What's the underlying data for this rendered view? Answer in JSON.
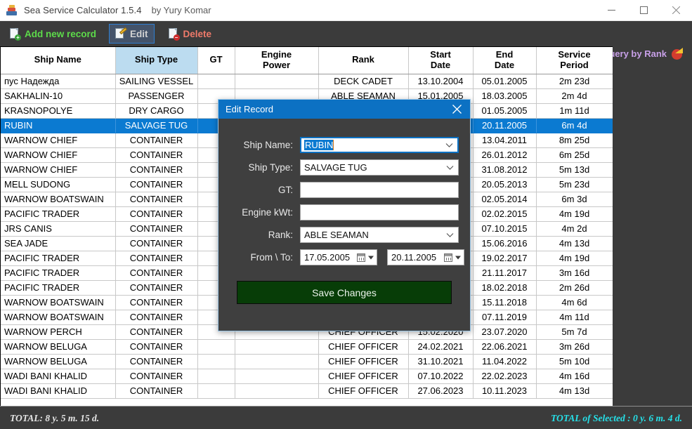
{
  "window": {
    "title": "Sea Service Calculator 1.5.4",
    "author": "by Yury Komar",
    "minimize": "—",
    "maximize": "□",
    "close": "✕"
  },
  "toolbar": {
    "add_label": "Add new record",
    "edit_label": "Edit",
    "delete_label": "Delete",
    "query_label": "Query by Rank"
  },
  "grid": {
    "columns": [
      {
        "label": "Ship Name",
        "key": "ship"
      },
      {
        "label": "Ship Type",
        "key": "type"
      },
      {
        "label": "GT",
        "key": "gt"
      },
      {
        "label": "Engine\nPower",
        "key": "engine"
      },
      {
        "label": "Rank",
        "key": "rank"
      },
      {
        "label": "Start\nDate",
        "key": "start"
      },
      {
        "label": "End\nDate",
        "key": "end"
      },
      {
        "label": "Service\nPeriod",
        "key": "period"
      }
    ],
    "selected_column": "Ship Type",
    "selected_row_index": 3,
    "rows": [
      {
        "ship": "пус Надежда",
        "type": "SAILING VESSEL",
        "gt": "",
        "engine": "",
        "rank": "DECK CADET",
        "start": "13.10.2004",
        "end": "05.01.2005",
        "period": "2m 23d"
      },
      {
        "ship": "SAKHALIN-10",
        "type": "PASSENGER",
        "gt": "",
        "engine": "",
        "rank": "ABLE SEAMAN",
        "start": "15.01.2005",
        "end": "18.03.2005",
        "period": "2m 4d"
      },
      {
        "ship": "KRASNOPOLYE",
        "type": "DRY CARGO",
        "gt": "",
        "engine": "",
        "rank": "",
        "start": "",
        "end": "01.05.2005",
        "period": "1m 11d"
      },
      {
        "ship": "RUBIN",
        "type": "SALVAGE TUG",
        "gt": "",
        "engine": "",
        "rank": "",
        "start": "",
        "end": "20.11.2005",
        "period": "6m 4d"
      },
      {
        "ship": "WARNOW CHIEF",
        "type": "CONTAINER",
        "gt": "",
        "engine": "",
        "rank": "",
        "start": "",
        "end": "13.04.2011",
        "period": "8m 25d"
      },
      {
        "ship": "WARNOW CHIEF",
        "type": "CONTAINER",
        "gt": "",
        "engine": "",
        "rank": "",
        "start": "",
        "end": "26.01.2012",
        "period": "6m 25d"
      },
      {
        "ship": "WARNOW CHIEF",
        "type": "CONTAINER",
        "gt": "",
        "engine": "",
        "rank": "",
        "start": "",
        "end": "31.08.2012",
        "period": "5m 13d"
      },
      {
        "ship": "MELL SUDONG",
        "type": "CONTAINER",
        "gt": "",
        "engine": "",
        "rank": "",
        "start": "",
        "end": "20.05.2013",
        "period": "5m 23d"
      },
      {
        "ship": "WARNOW BOATSWAIN",
        "type": "CONTAINER",
        "gt": "",
        "engine": "",
        "rank": "",
        "start": "",
        "end": "02.05.2014",
        "period": "6m 3d"
      },
      {
        "ship": "PACIFIC TRADER",
        "type": "CONTAINER",
        "gt": "",
        "engine": "",
        "rank": "",
        "start": "",
        "end": "02.02.2015",
        "period": "4m 19d"
      },
      {
        "ship": "JRS CANIS",
        "type": "CONTAINER",
        "gt": "",
        "engine": "",
        "rank": "",
        "start": "",
        "end": "07.10.2015",
        "period": "4m 2d"
      },
      {
        "ship": "SEA JADE",
        "type": "CONTAINER",
        "gt": "",
        "engine": "",
        "rank": "",
        "start": "",
        "end": "15.06.2016",
        "period": "4m 13d"
      },
      {
        "ship": "PACIFIC TRADER",
        "type": "CONTAINER",
        "gt": "",
        "engine": "",
        "rank": "",
        "start": "",
        "end": "19.02.2017",
        "period": "4m 19d"
      },
      {
        "ship": "PACIFIC TRADER",
        "type": "CONTAINER",
        "gt": "",
        "engine": "",
        "rank": "",
        "start": "",
        "end": "21.11.2017",
        "period": "3m 16d"
      },
      {
        "ship": "PACIFIC TRADER",
        "type": "CONTAINER",
        "gt": "",
        "engine": "",
        "rank": "",
        "start": "",
        "end": "18.02.2018",
        "period": "2m 26d"
      },
      {
        "ship": "WARNOW BOATSWAIN",
        "type": "CONTAINER",
        "gt": "",
        "engine": "",
        "rank": "",
        "start": "",
        "end": "15.11.2018",
        "period": "4m 6d"
      },
      {
        "ship": "WARNOW BOATSWAIN",
        "type": "CONTAINER",
        "gt": "",
        "engine": "",
        "rank": "",
        "start": "",
        "end": "07.11.2019",
        "period": "4m 11d"
      },
      {
        "ship": "WARNOW PERCH",
        "type": "CONTAINER",
        "gt": "",
        "engine": "",
        "rank": "CHIEF OFFICER",
        "start": "15.02.2020",
        "end": "23.07.2020",
        "period": "5m 7d"
      },
      {
        "ship": "WARNOW BELUGA",
        "type": "CONTAINER",
        "gt": "",
        "engine": "",
        "rank": "CHIEF OFFICER",
        "start": "24.02.2021",
        "end": "22.06.2021",
        "period": "3m 26d"
      },
      {
        "ship": "WARNOW BELUGA",
        "type": "CONTAINER",
        "gt": "",
        "engine": "",
        "rank": "CHIEF OFFICER",
        "start": "31.10.2021",
        "end": "11.04.2022",
        "period": "5m 10d"
      },
      {
        "ship": "WADI BANI KHALID",
        "type": "CONTAINER",
        "gt": "",
        "engine": "",
        "rank": "CHIEF OFFICER",
        "start": "07.10.2022",
        "end": "22.02.2023",
        "period": "4m 16d"
      },
      {
        "ship": "WADI BANI KHALID",
        "type": "CONTAINER",
        "gt": "",
        "engine": "",
        "rank": "CHIEF OFFICER",
        "start": "27.06.2023",
        "end": "10.11.2023",
        "period": "4m 13d"
      }
    ]
  },
  "dialog": {
    "title": "Edit Record",
    "close": "✕",
    "labels": {
      "ship_name": "Ship Name:",
      "ship_type": "Ship Type:",
      "gt": "GT:",
      "engine_kwt": "Engine kWt:",
      "rank": "Rank:",
      "from_to": "From \\ To:"
    },
    "values": {
      "ship_name": "RUBIN",
      "ship_type": "SALVAGE TUG",
      "gt": "",
      "engine_kwt": "",
      "rank": "ABLE SEAMAN",
      "date_from": "17.05.2005",
      "date_to": "20.11.2005"
    },
    "save_label": "Save Changes"
  },
  "status": {
    "total": "TOTAL:  8 y.  5 m.  15 d.",
    "total_selected": "TOTAL of Selected :  0 y.  6 m.  4 d."
  },
  "colors": {
    "accent_blue": "#0b7ad1",
    "toolbar_bg": "#3b3b3b",
    "header_sel": "#bcdcf0",
    "save_green": "#073d07",
    "status_cyan": "#26e0e8",
    "query_purple": "#c8a0e8"
  }
}
